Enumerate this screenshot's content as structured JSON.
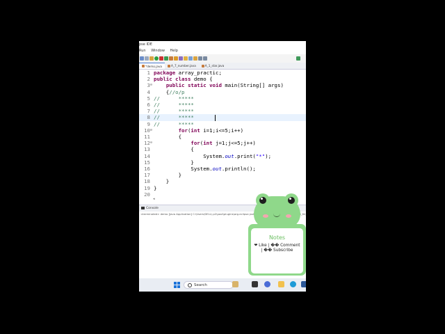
{
  "window": {
    "title": "pse IDE"
  },
  "menu": [
    "Run",
    "Window",
    "Help"
  ],
  "tabs": [
    {
      "label": "*demo.java",
      "active": true
    },
    {
      "label": "A_7_number.java",
      "active": false
    },
    {
      "label": "A_1_star.java",
      "active": false
    }
  ],
  "editor": {
    "lines": [
      {
        "n": "1",
        "fold": "",
        "html": "<span class=\"kw\">package</span> array_practic;"
      },
      {
        "n": "2",
        "fold": "",
        "html": "<span class=\"kw\">public class</span> demo {"
      },
      {
        "n": "3",
        "fold": "⊖",
        "html": "    <span class=\"kw\">public static void</span> main(String[] args)"
      },
      {
        "n": "4",
        "fold": "",
        "html": "    {<span class=\"cm\">//o/p</span>"
      },
      {
        "n": "5",
        "fold": "",
        "html": "<span class=\"cm\">//      *****</span>"
      },
      {
        "n": "6",
        "fold": "",
        "html": "<span class=\"cm\">//      *****</span>"
      },
      {
        "n": "7",
        "fold": "",
        "html": "<span class=\"cm\">//      *****</span>"
      },
      {
        "n": "8",
        "fold": "",
        "html": "<span class=\"cm\">//      *****</span>"
      },
      {
        "n": "9",
        "fold": "",
        "html": "<span class=\"cm\">//      *****</span>"
      },
      {
        "n": "10",
        "fold": "⊖",
        "html": "        <span class=\"kw\">for</span>(<span class=\"kw\">int</span> i=1;i<=5;i++)"
      },
      {
        "n": "11",
        "fold": "",
        "html": "        {"
      },
      {
        "n": "12",
        "fold": "⊖",
        "html": "            <span class=\"kw\">for</span>(<span class=\"kw\">int</span> j=1;j<=5;j++)"
      },
      {
        "n": "13",
        "fold": "",
        "html": "            {"
      },
      {
        "n": "14",
        "fold": "",
        "html": "                System.<span class=\"it\">out</span>.print(<span class=\"st\">\"*\"</span>);"
      },
      {
        "n": "15",
        "fold": "",
        "html": "            }"
      },
      {
        "n": "16",
        "fold": "",
        "html": "            System.<span class=\"it\">out</span>.println();"
      },
      {
        "n": "17",
        "fold": "",
        "html": "        }"
      },
      {
        "n": "18",
        "fold": "",
        "html": "    }"
      },
      {
        "n": "19",
        "fold": "",
        "html": "}"
      },
      {
        "n": "20",
        "fold": "",
        "html": ""
      }
    ],
    "current_line": 8
  },
  "console": {
    "tab_label": "Console",
    "status_text": "<terminated> demo [Java Application] C:\\Users\\DELL\\.p2\\pool\\plugins\\org.eclipse.justj.openjdk.hotspot.jre.full.win32.x86_64_21.0.1.v20231028-0858\\jre"
  },
  "taskbar": {
    "search_label": "Search"
  },
  "notes": {
    "title": "Notes",
    "body": "❤ Like | �� Comment | �� Subscribe"
  }
}
